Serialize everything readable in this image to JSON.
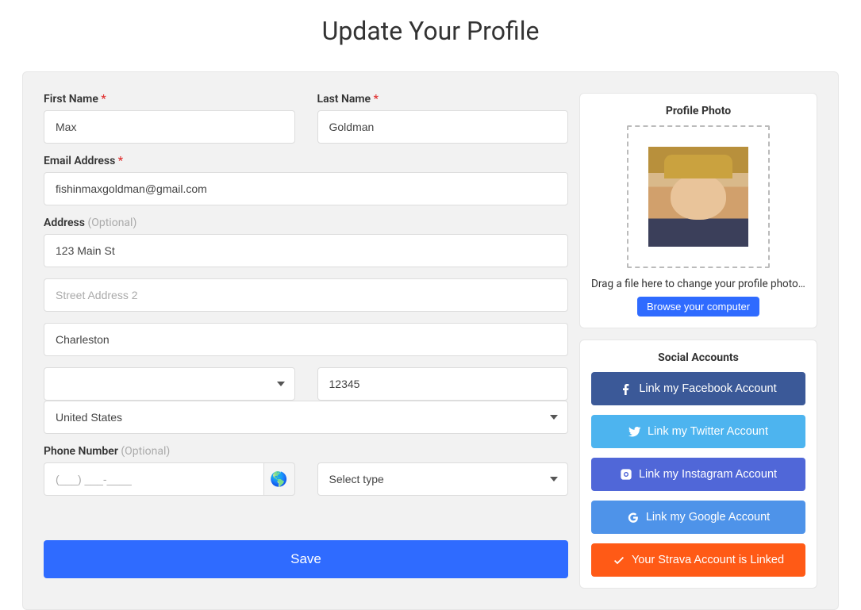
{
  "page": {
    "title": "Update Your Profile"
  },
  "labels": {
    "first_name": "First Name",
    "last_name": "Last Name",
    "email": "Email Address",
    "address": "Address",
    "phone": "Phone Number",
    "optional": "(Optional)"
  },
  "form": {
    "first_name": "Max",
    "last_name": "Goldman",
    "email": "fishinmaxgoldman@gmail.com",
    "street1": "123 Main St",
    "street2_placeholder": "Street Address 2",
    "city": "Charleston",
    "state": "",
    "zip": "12345",
    "country": "United States",
    "phone_placeholder": "(___) ___-____",
    "phone_type_placeholder": "Select type"
  },
  "actions": {
    "save": "Save"
  },
  "photo": {
    "title": "Profile Photo",
    "drop_text": "Drag a file here to change your profile photo or …",
    "browse": "Browse your computer"
  },
  "social": {
    "title": "Social Accounts",
    "facebook": "Link my Facebook Account",
    "twitter": "Link my Twitter Account",
    "instagram": "Link my Instagram Account",
    "google": "Link my Google Account",
    "strava": "Your Strava Account is Linked"
  }
}
